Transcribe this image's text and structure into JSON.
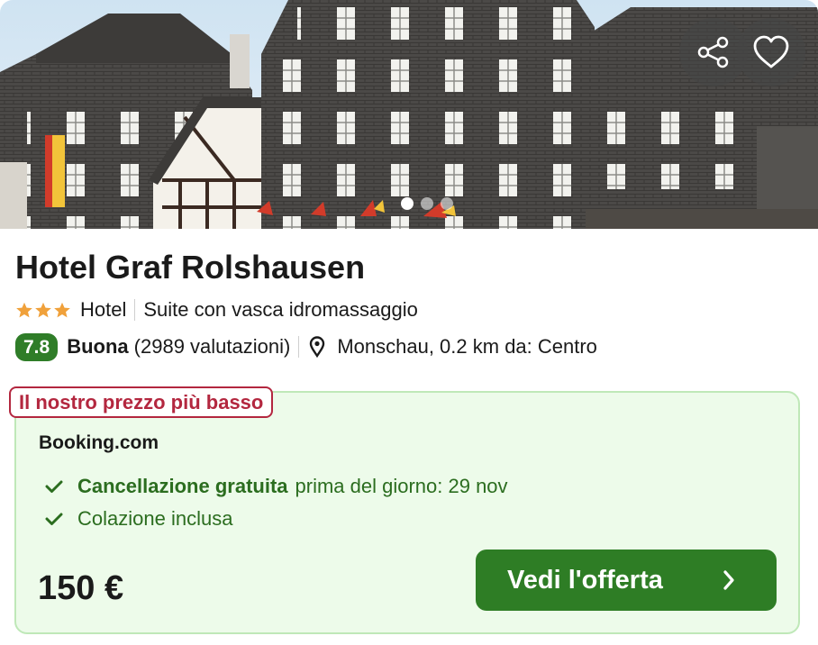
{
  "hero": {
    "image_icon": "hotel-photo",
    "share_icon": "share-icon",
    "favorite_icon": "heart-outline-icon",
    "carousel_dots": 3,
    "active_dot": 1
  },
  "hotel": {
    "name": "Hotel Graf Rolshausen",
    "stars": 3,
    "star_color": "#f0a13b",
    "type": "Hotel",
    "room": "Suite con vasca idromassaggio",
    "score": "7.8",
    "score_color": "#2f7d28",
    "rating_word": "Buona",
    "reviews": "(2989 valutazioni)",
    "location": "Monschau, 0.2 km da: Centro"
  },
  "offer": {
    "badge": "Il nostro prezzo più basso",
    "badge_color": "#b3273f",
    "provider": "Booking.com",
    "features": [
      {
        "bold": "Cancellazione gratuita",
        "text": "prima del giorno: 29 nov"
      },
      {
        "bold": "",
        "text": "Colazione inclusa"
      }
    ],
    "price": "150 €",
    "cta": "Vedi l'offerta",
    "accent": "#2e7d25",
    "background": "#edfbea"
  }
}
